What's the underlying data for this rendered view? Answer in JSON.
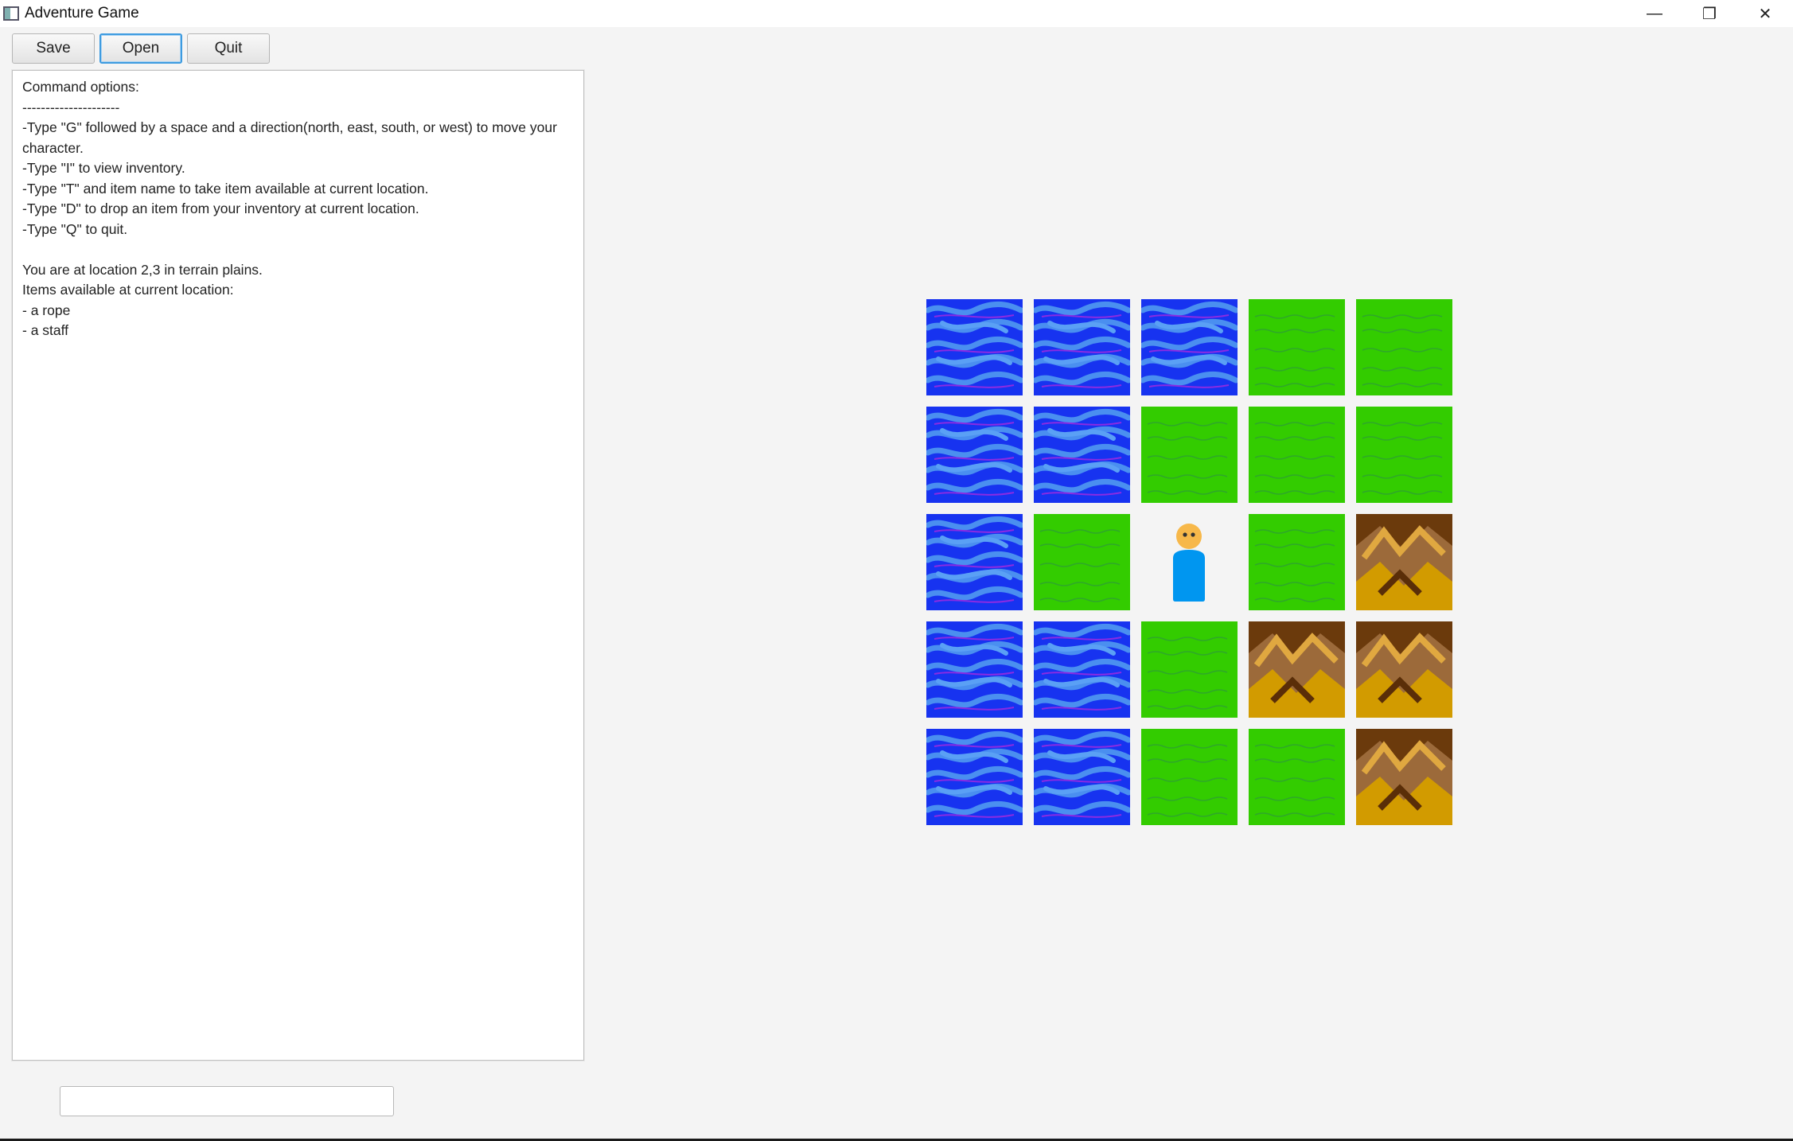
{
  "window": {
    "title": "Adventure Game",
    "controls": {
      "minimize": "—",
      "restore": "❐",
      "close": "✕"
    }
  },
  "toolbar": {
    "save_label": "Save",
    "open_label": "Open",
    "quit_label": "Quit"
  },
  "console": {
    "lines": [
      "Command options:",
      "---------------------",
      "-Type \"G\" followed by a space and a direction(north, east, south, or west) to move your character.",
      "-Type \"I\" to view inventory.",
      "-Type \"T\" and item name to take item available at current location.",
      "-Type \"D\" to drop an item from your inventory at current location.",
      "-Type \"Q\" to quit.",
      "",
      "You are at location 2,3 in terrain plains.",
      "Items available at current location:",
      "- a rope",
      "- a staff"
    ]
  },
  "command_input": {
    "value": "",
    "placeholder": ""
  },
  "map": {
    "rows": [
      [
        "water",
        "water",
        "water",
        "plains",
        "plains"
      ],
      [
        "water",
        "water",
        "plains",
        "plains",
        "plains"
      ],
      [
        "water",
        "plains",
        "player",
        "plains",
        "mountains"
      ],
      [
        "water",
        "water",
        "plains",
        "mountains",
        "mountains"
      ],
      [
        "water",
        "water",
        "plains",
        "plains",
        "mountains"
      ]
    ],
    "player_position": {
      "row": 2,
      "col": 2
    },
    "terrain_colors": {
      "water": "#1733f0",
      "plains": "#33cc00",
      "mountains": "#6b3a0c",
      "player": "#0096f0"
    }
  }
}
